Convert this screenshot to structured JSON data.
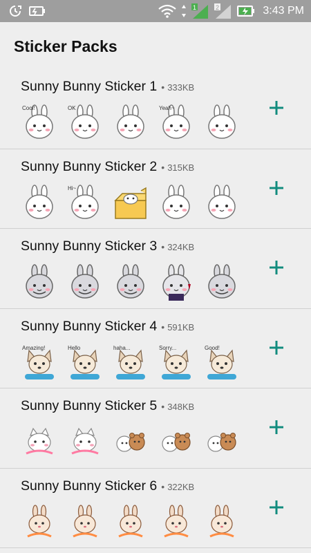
{
  "status_bar": {
    "time": "3:43 PM",
    "icons": [
      "sync-icon",
      "battery-saver-icon",
      "wifi-icon",
      "data-arrows-icon",
      "signal-sim1-icon",
      "signal-sim2-icon",
      "battery-charging-icon"
    ],
    "sim1_badge": "1",
    "sim2_badge": "2"
  },
  "header": {
    "title": "Sticker Packs"
  },
  "accent_color": "#128c7e",
  "packs": [
    {
      "name": "Sunny Bunny Sticker 1",
      "separator": "•",
      "size": "333KB",
      "stickers": [
        {
          "icon": "white-bunny-sticker",
          "caption": "Cool!"
        },
        {
          "icon": "white-bunny-sticker",
          "caption": "OK"
        },
        {
          "icon": "white-bunny-sticker",
          "caption": ""
        },
        {
          "icon": "white-bunny-sticker",
          "caption": "Yeah~"
        },
        {
          "icon": "white-bunny-sticker",
          "caption": ""
        }
      ]
    },
    {
      "name": "Sunny Bunny Sticker 2",
      "separator": "•",
      "size": "315KB",
      "stickers": [
        {
          "icon": "white-bunny-sticker",
          "caption": ""
        },
        {
          "icon": "white-bunny-sticker",
          "caption": "Hi~"
        },
        {
          "icon": "bunny-in-box-sticker",
          "caption": ""
        },
        {
          "icon": "white-bunny-sticker",
          "caption": ""
        },
        {
          "icon": "white-bunny-sticker",
          "caption": ""
        }
      ]
    },
    {
      "name": "Sunny Bunny Sticker 3",
      "separator": "•",
      "size": "324KB",
      "stickers": [
        {
          "icon": "grey-bunny-sticker",
          "caption": ""
        },
        {
          "icon": "grey-bunny-sticker",
          "caption": ""
        },
        {
          "icon": "grey-bunny-sticker",
          "caption": ""
        },
        {
          "icon": "bunny-suit-sticker",
          "caption": ""
        },
        {
          "icon": "grey-bunny-sticker",
          "caption": ""
        }
      ]
    },
    {
      "name": "Sunny Bunny Sticker 4",
      "separator": "•",
      "size": "591KB",
      "stickers": [
        {
          "icon": "puppy-sticker",
          "caption": "Amazing!"
        },
        {
          "icon": "puppy-sticker",
          "caption": "Hello"
        },
        {
          "icon": "puppy-sticker",
          "caption": "haha..."
        },
        {
          "icon": "puppy-sticker",
          "caption": "Sorry..."
        },
        {
          "icon": "puppy-sticker",
          "caption": "Good!"
        }
      ]
    },
    {
      "name": "Sunny Bunny Sticker 5",
      "separator": "•",
      "size": "348KB",
      "stickers": [
        {
          "icon": "kitten-sticker",
          "caption": ""
        },
        {
          "icon": "kitten-sticker",
          "caption": ""
        },
        {
          "icon": "kitten-bear-sticker",
          "caption": ""
        },
        {
          "icon": "kitten-bear-sticker",
          "caption": ""
        },
        {
          "icon": "kitten-bear-sticker",
          "caption": ""
        }
      ]
    },
    {
      "name": "Sunny Bunny Sticker 6",
      "separator": "•",
      "size": "322KB",
      "stickers": [
        {
          "icon": "brown-bunny-sticker",
          "caption": ""
        },
        {
          "icon": "brown-bunny-sticker",
          "caption": ""
        },
        {
          "icon": "brown-bunny-sticker",
          "caption": ""
        },
        {
          "icon": "brown-bunny-sticker",
          "caption": ""
        },
        {
          "icon": "brown-bunny-sticker",
          "caption": ""
        }
      ]
    }
  ]
}
